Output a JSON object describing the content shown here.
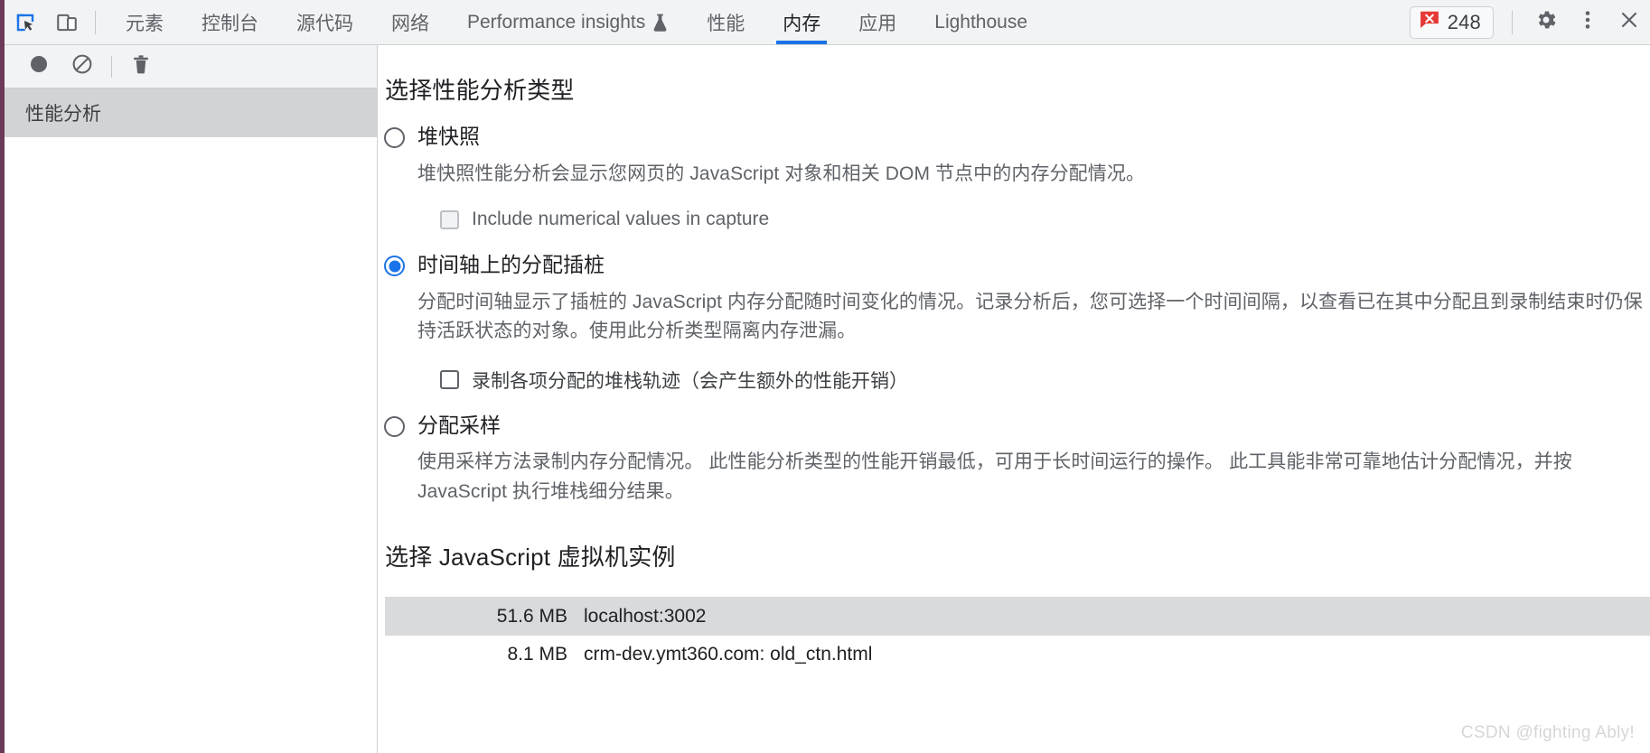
{
  "window": {
    "accent_strip_color": "#6b3a58",
    "active_tab_color": "#1a73e8"
  },
  "toolbar": {
    "inspect_icon": "inspect-element-icon",
    "device_icon": "device-toolbar-icon",
    "tabs": [
      {
        "label": "元素",
        "active": false,
        "icon": null
      },
      {
        "label": "控制台",
        "active": false,
        "icon": null
      },
      {
        "label": "源代码",
        "active": false,
        "icon": null
      },
      {
        "label": "网络",
        "active": false,
        "icon": null
      },
      {
        "label": "Performance insights",
        "active": false,
        "icon": "flask-icon"
      },
      {
        "label": "性能",
        "active": false,
        "icon": null
      },
      {
        "label": "内存",
        "active": true,
        "icon": null
      },
      {
        "label": "应用",
        "active": false,
        "icon": null
      },
      {
        "label": "Lighthouse",
        "active": false,
        "icon": null
      }
    ],
    "error_badge": {
      "icon": "error-icon",
      "count": "248",
      "color": "#e53935"
    },
    "settings_icon": "gear-icon",
    "more_icon": "kebab-menu-icon",
    "close_icon": "close-icon"
  },
  "sidebar": {
    "toolbar_buttons": [
      {
        "name": "record-button",
        "icon": "record-circle-icon"
      },
      {
        "name": "clear-button",
        "icon": "ban-circle-icon"
      },
      {
        "name": "delete-button",
        "icon": "trash-icon"
      }
    ],
    "items": [
      {
        "label": "性能分析",
        "selected": true
      }
    ]
  },
  "main": {
    "profiling_section_title": "选择性能分析类型",
    "profile_types": [
      {
        "id": "heap-snapshot",
        "label": "堆快照",
        "selected": false,
        "description": "堆快照性能分析会显示您网页的 JavaScript 对象和相关 DOM 节点中的内存分配情况。",
        "option": {
          "label": "Include numerical values in capture",
          "checked": false,
          "disabled": true
        }
      },
      {
        "id": "allocation-instrumentation-timeline",
        "label": "时间轴上的分配插桩",
        "selected": true,
        "description": "分配时间轴显示了插桩的 JavaScript 内存分配随时间变化的情况。记录分析后，您可选择一个时间间隔，以查看已在其中分配且到录制结束时仍保持活跃状态的对象。使用此分析类型隔离内存泄漏。",
        "option": {
          "label": "录制各项分配的堆栈轨迹（会产生额外的性能开销）",
          "checked": false,
          "disabled": false
        }
      },
      {
        "id": "allocation-sampling",
        "label": "分配采样",
        "selected": false,
        "description": "使用采样方法录制内存分配情况。 此性能分析类型的性能开销最低，可用于长时间运行的操作。 此工具能非常可靠地估计分配情况，并按 JavaScript 执行堆栈细分结果。",
        "option": null
      }
    ],
    "vm_section_title": "选择 JavaScript 虚拟机实例",
    "vm_instances": [
      {
        "size": "51.6 MB",
        "name": "localhost:3002",
        "selected": true
      },
      {
        "size": "8.1 MB",
        "name": "crm-dev.ymt360.com: old_ctn.html",
        "selected": false
      }
    ]
  },
  "watermark": {
    "text": "CSDN @fighting Ably!"
  }
}
